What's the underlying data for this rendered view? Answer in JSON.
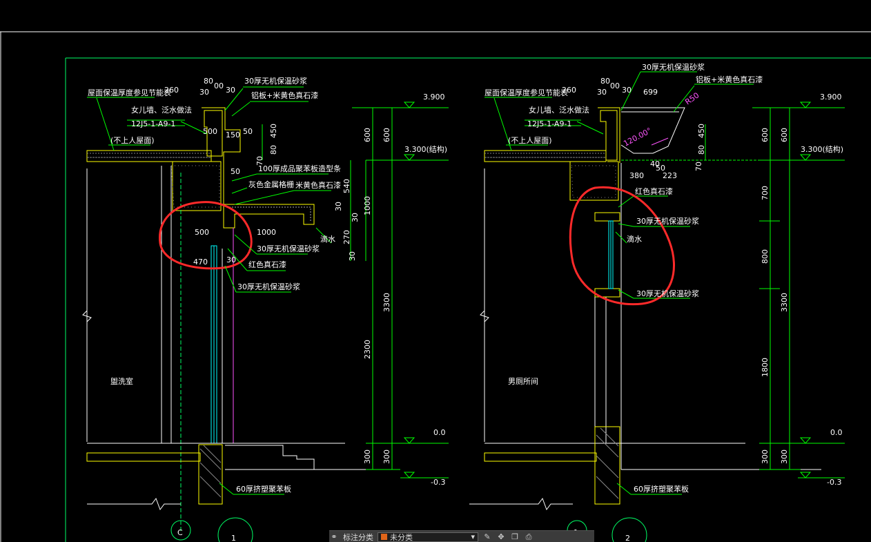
{
  "colors": {
    "frame": "#ffffff",
    "border": "#00ff66",
    "wall": "#ffff00",
    "dim": "#00ff00",
    "text": "#ffffff",
    "window": "#00ffff",
    "annotation": "#ff2a2a",
    "magenta": "#ff55ff"
  },
  "drawing1": {
    "roof_insulation_note": "屋面保温厚度参见节能表",
    "parapet_note": "女儿墙、泛水做法",
    "parapet_ref": "12J5-1-A9-1",
    "roof_note": "(不上人屋面)",
    "layer_top": "30厚无机保温砂浆",
    "layer_alum": "铝板+米黄色真石漆",
    "layer_100": "100厚成品聚苯板造型条",
    "layer_grey": "灰色金属格栅",
    "layer_beige": "米黄色真石漆",
    "layer_30b": "30厚无机保温砂浆",
    "layer_red": "红色真石漆",
    "layer_30c": "30厚无机保温砂浆",
    "drip": "滴水",
    "bottom_note": "60厚挤塑聚苯板",
    "room": "盥洗室",
    "elev_top": "3.900",
    "elev_struct": "3.300(结构)",
    "elev_zero": "0.0",
    "elev_neg": "-0.3",
    "dims": [
      "260",
      "80",
      "30",
      "00",
      "30",
      "500",
      "150",
      "50",
      "450",
      "80",
      "70",
      "50",
      "540",
      "1000",
      "30",
      "270",
      "30",
      "30",
      "500",
      "470",
      "1000",
      "30",
      "600",
      "600",
      "2300",
      "3300",
      "300",
      "300"
    ],
    "axis": "C",
    "detail_no": "1"
  },
  "drawing2": {
    "layer_top": "30厚无机保温砂浆",
    "layer_alum": "铝板+米黄色真石漆",
    "roof_insulation_note": "屋面保温厚度参见节能表",
    "parapet_note": "女儿墙、泛水做法",
    "parapet_ref": "12J5-1-A9-1",
    "roof_note": "(不上人屋面)",
    "layer_red": "红色真石漆",
    "layer_30a": "30厚无机保温砂浆",
    "drip": "滴水",
    "layer_30b": "30厚无机保温砂浆",
    "bottom_note": "60厚挤塑聚苯板",
    "room": "男厕所间",
    "angle": "120.00°",
    "radius": "R50",
    "elev_top": "3.900",
    "elev_struct": "3.300(结构)",
    "elev_zero": "0.0",
    "elev_neg": "-0.3",
    "dims": [
      "260",
      "80",
      "30",
      "00",
      "30",
      "699",
      "450",
      "80",
      "70",
      "380",
      "40",
      "50",
      "223",
      "600",
      "600",
      "700",
      "800",
      "1800",
      "3300",
      "300",
      "300"
    ],
    "detail_no": "2",
    "detail_no_mid": "1"
  },
  "toolbar": {
    "label": "标注分类",
    "select_value": "未分类"
  }
}
